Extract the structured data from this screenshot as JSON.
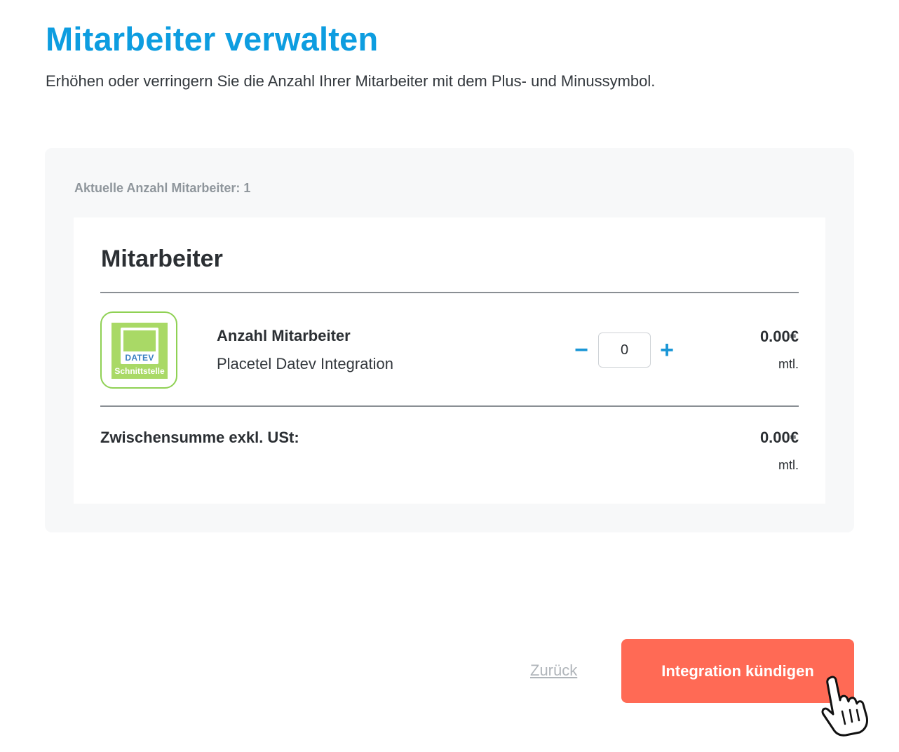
{
  "header": {
    "title": "Mitarbeiter verwalten",
    "subtitle": "Erhöhen oder verringern Sie die Anzahl Ihrer Mitarbeiter mit dem Plus- und Minussymbol."
  },
  "card": {
    "current_count_label": "Aktuelle Anzahl Mitarbeiter: 1",
    "section_title": "Mitarbeiter",
    "item": {
      "logo_text": "DATEV",
      "logo_label": "Schnittstelle",
      "name": "Anzahl Mitarbeiter",
      "description": "Placetel Datev Integration",
      "quantity": "0",
      "minus_symbol": "−",
      "plus_symbol": "+",
      "price": "0.00€",
      "period": "mtl."
    },
    "subtotal": {
      "label": "Zwischensumme exkl. USt:",
      "price": "0.00€",
      "period": "mtl."
    }
  },
  "footer": {
    "back_label": "Zurück",
    "cancel_label": "Integration kündigen"
  },
  "colors": {
    "accent": "#0d9de0",
    "stepper": "#1a96d6",
    "danger": "#ff6a55",
    "logo_green": "#a9d966"
  },
  "icons": {
    "minus": "minus-icon",
    "plus": "plus-icon",
    "cursor": "hand-pointer-icon"
  }
}
